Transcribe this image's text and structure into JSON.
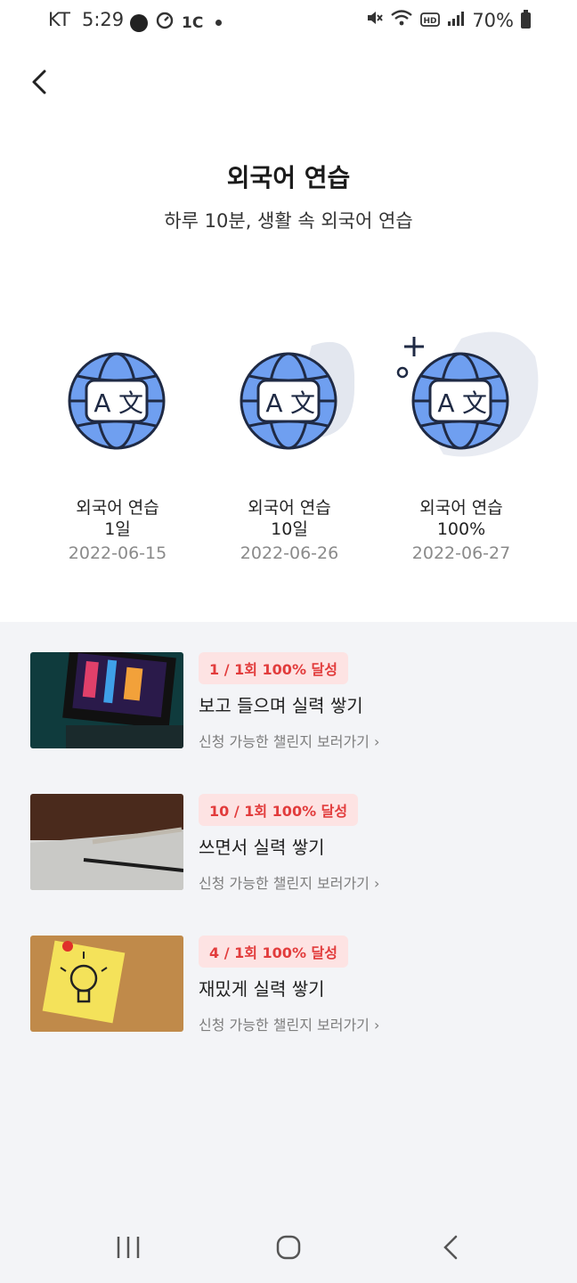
{
  "status": {
    "carrier": "KT",
    "time": "5:29",
    "notif_glyph": "1С",
    "battery": "70%"
  },
  "header": {
    "title": "외국어 연습",
    "subtitle": "하루 10분, 생활 속 외국어 연습"
  },
  "badges": [
    {
      "name": "외국어 연습",
      "level": "1일",
      "date": "2022-06-15"
    },
    {
      "name": "외국어 연습",
      "level": "10일",
      "date": "2022-06-26"
    },
    {
      "name": "외국어 연습",
      "level": "100%",
      "date": "2022-06-27"
    }
  ],
  "challenges": [
    {
      "pill": "1 / 1회 100% 달성",
      "title": "보고 들으며 실력 쌓기",
      "link": "신청 가능한 챌린지 보러가기 ›"
    },
    {
      "pill": "10 / 1회 100% 달성",
      "title": "쓰면서 실력 쌓기",
      "link": "신청 가능한 챌린지 보러가기 ›"
    },
    {
      "pill": "4 / 1회 100% 달성",
      "title": "재밌게 실력 쌓기",
      "link": "신청 가능한 챌린지 보러가기 ›"
    }
  ],
  "colors": {
    "accent_red": "#e23c3c",
    "pill_bg": "#fde3e3",
    "globe_blue": "#6f9ff0",
    "section_bg": "#f3f4f7"
  },
  "icons": {
    "back": "chevron-left-icon",
    "badge": "translate-globe-icon",
    "nav_recent": "recent-apps-icon",
    "nav_home": "home-icon",
    "nav_back": "back-icon"
  }
}
